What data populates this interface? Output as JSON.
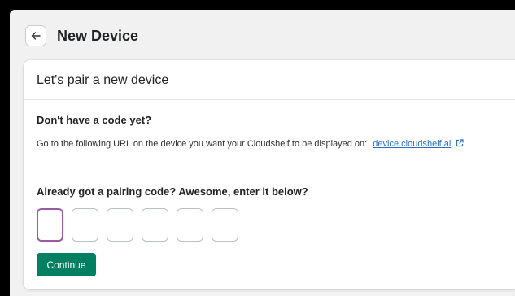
{
  "header": {
    "back_icon": "arrow-left-icon",
    "title": "New Device"
  },
  "card": {
    "title": "Let's pair a new device",
    "no_code": {
      "heading": "Don't have a code yet?",
      "instruction": "Go to the following URL on the device you want your Cloudshelf to be displayed on:",
      "link_text": "device.cloudshelf.ai",
      "link_icon": "external-link-icon"
    },
    "pairing": {
      "heading": "Already got a pairing code? Awesome, enter it below?",
      "code_digits": [
        "",
        "",
        "",
        "",
        "",
        ""
      ],
      "continue_label": "Continue"
    }
  },
  "colors": {
    "primary_button": "#008060",
    "focus_border": "#9b5aa3",
    "link": "#2c6ecb"
  }
}
